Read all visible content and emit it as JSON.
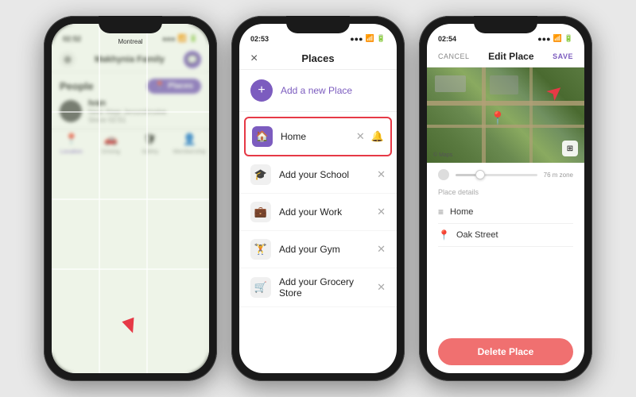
{
  "phone1": {
    "status": {
      "time": "02:52",
      "icons": "●●●"
    },
    "header": {
      "title": "Makhynia Family",
      "gear_icon": "⚙",
      "chat_icon": "💬"
    },
    "map": {
      "label": "Montreal"
    },
    "bottom": {
      "people_label": "People",
      "places_button": "Places",
      "person": {
        "name": "Ivan",
        "location": "Near Aleje Jerozolimskie",
        "time": "Since 02:51"
      }
    },
    "tabs": [
      {
        "label": "Location",
        "icon": "📍",
        "active": true
      },
      {
        "label": "Driving",
        "icon": "🚗",
        "active": false
      },
      {
        "label": "Safety",
        "icon": "🛡",
        "active": false
      },
      {
        "label": "Membership",
        "icon": "👤",
        "active": false
      }
    ]
  },
  "phone2": {
    "status": {
      "time": "02:53"
    },
    "header": {
      "title": "Places",
      "close_icon": "×"
    },
    "add_place": {
      "label": "Add a new Place",
      "icon": "+"
    },
    "items": [
      {
        "label": "Home",
        "icon": "🏠",
        "highlighted": true,
        "has_close": true,
        "has_bell": true
      },
      {
        "label": "Add your School",
        "icon": "🎓",
        "highlighted": false,
        "has_close": true,
        "muted": false
      },
      {
        "label": "Add your Work",
        "icon": "💼",
        "highlighted": false,
        "has_close": true,
        "muted": false
      },
      {
        "label": "Add your Gym",
        "icon": "🏋",
        "highlighted": false,
        "has_close": true,
        "muted": false
      },
      {
        "label": "Add your Grocery Store",
        "icon": "🛒",
        "highlighted": false,
        "has_close": true,
        "muted": false
      }
    ]
  },
  "phone3": {
    "status": {
      "time": "02:54"
    },
    "header": {
      "cancel": "CANCEL",
      "title": "Edit Place",
      "save": "SAVE"
    },
    "map": {
      "label": "© Maps",
      "layers_icon": "⊞",
      "zone_label": "76 m zone"
    },
    "radius": {
      "zone_text": "76 m zone"
    },
    "place_details": {
      "section_title": "Place details",
      "name": "Home",
      "address": "Oak Street"
    },
    "delete_button": "Delete Place"
  }
}
